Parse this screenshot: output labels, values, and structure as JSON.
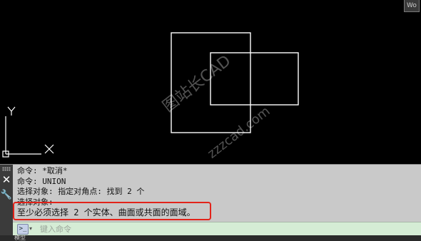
{
  "app": {
    "viewcube_label": "Wo"
  },
  "drawing": {
    "ucs_x_label": "X",
    "ucs_y_label": "Y",
    "watermark_lines": [
      "图站长CAD",
      "zzzcad.com"
    ]
  },
  "command_line": {
    "history": [
      "命令: *取消*",
      "命令: UNION",
      "选择对象: 指定对角点: 找到 2 个",
      "选择对象:",
      "至少必须选择 2 个实体、曲面或共面的面域。"
    ],
    "input_placeholder": "键入命令",
    "close_icon": "close-icon",
    "customize_icon": "wrench-icon",
    "prompt_icon": "command-prompt-icon"
  },
  "statusbar": {
    "tab_label": "模型"
  },
  "colors": {
    "canvas": "#000000",
    "geometry": "#ffffff",
    "panel": "#c9c9c9",
    "input": "#d5ecd5",
    "highlight": "#e2231a"
  }
}
